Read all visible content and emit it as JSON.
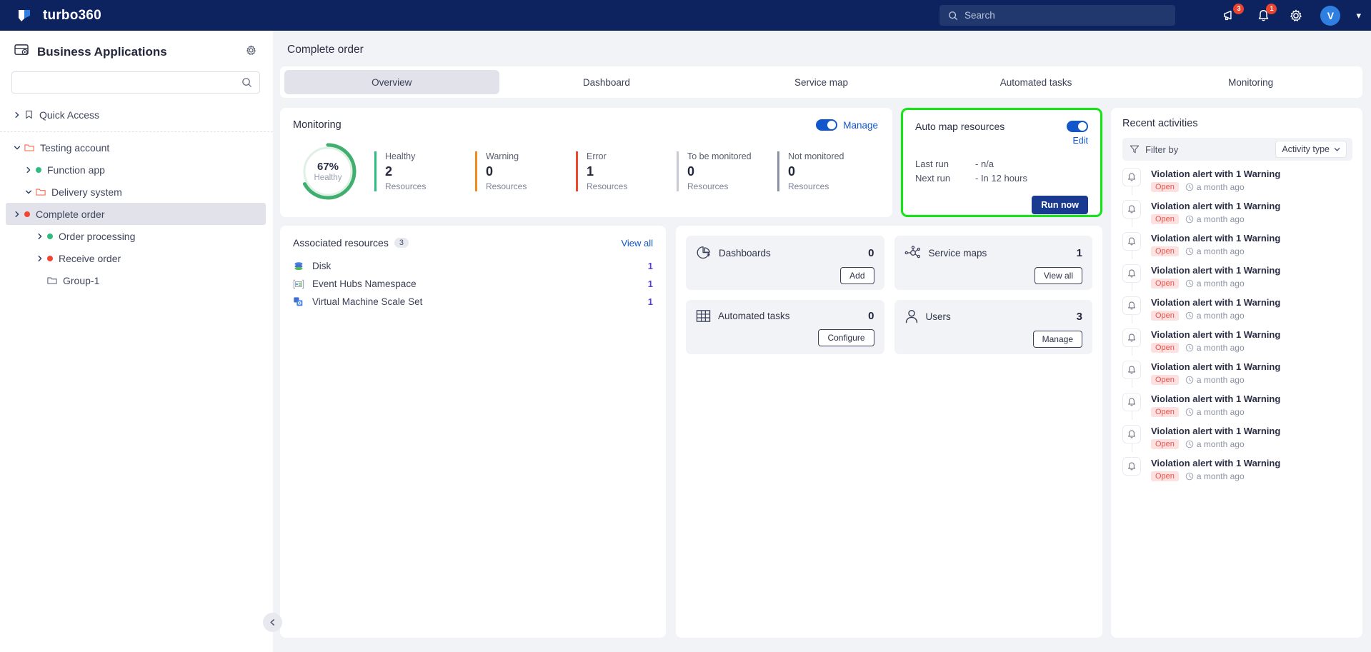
{
  "header": {
    "brand": "turbo360",
    "logo_icon": "turbo-logo-icon",
    "search_placeholder": "Search",
    "search_icon": "search-icon",
    "announcement_icon": "megaphone-icon",
    "announcement_badge": "3",
    "notification_icon": "bell-icon",
    "notification_badge": "1",
    "settings_icon": "gear-icon",
    "avatar_initial": "V",
    "avatar_chevron_icon": "chevron-down-icon"
  },
  "sidebar": {
    "title": "Business Applications",
    "title_icon": "business-applications-icon",
    "settings_icon": "gear-icon",
    "search_value": "",
    "search_icon": "search-icon",
    "collapse_icon": "chevron-left-icon",
    "tree": [
      {
        "label": "Quick Access",
        "icon": "bookmark-icon",
        "chevron": "right",
        "indent": 0,
        "selected": false
      },
      {
        "label": "Testing account",
        "icon": "folder-icon-orange",
        "chevron": "down",
        "indent": 0,
        "selected": false
      },
      {
        "label": "Function app",
        "icon": "status-dot-green",
        "chevron": "right",
        "indent": 1,
        "selected": false
      },
      {
        "label": "Delivery system",
        "icon": "folder-icon-orange",
        "chevron": "down",
        "indent": 1,
        "selected": false
      },
      {
        "label": "Complete order",
        "icon": "status-dot-red",
        "chevron": "right",
        "indent": 2,
        "selected": true
      },
      {
        "label": "Order processing",
        "icon": "status-dot-green",
        "chevron": "right",
        "indent": 2,
        "selected": false
      },
      {
        "label": "Receive order",
        "icon": "status-dot-red",
        "chevron": "right",
        "indent": 2,
        "selected": false
      },
      {
        "label": "Group-1",
        "icon": "folder-icon-gray",
        "chevron": "none",
        "indent": 2,
        "selected": false
      }
    ]
  },
  "page": {
    "title": "Complete order",
    "tabs": [
      {
        "label": "Overview",
        "active": true
      },
      {
        "label": "Dashboard",
        "active": false
      },
      {
        "label": "Service map",
        "active": false
      },
      {
        "label": "Automated tasks",
        "active": false
      },
      {
        "label": "Monitoring",
        "active": false
      }
    ]
  },
  "monitoring": {
    "title": "Monitoring",
    "manage_label": "Manage",
    "toggle_on": true,
    "donut": {
      "percent": "67%",
      "sub": "Healthy",
      "value": 67,
      "color": "#3fae6f",
      "track": "#dff0e5"
    },
    "stats": [
      {
        "key": "Healthy",
        "value": "2",
        "unit": "Resources",
        "color": "#2ebd7e"
      },
      {
        "key": "Warning",
        "value": "0",
        "unit": "Resources",
        "color": "#f08a1c"
      },
      {
        "key": "Error",
        "value": "1",
        "unit": "Resources",
        "color": "#f1452f"
      },
      {
        "key": "To be monitored",
        "value": "0",
        "unit": "Resources",
        "color": "#c7cad4"
      },
      {
        "key": "Not monitored",
        "value": "0",
        "unit": "Resources",
        "color": "#8b90a2"
      }
    ]
  },
  "auto_map": {
    "title": "Auto map resources",
    "toggle_on": true,
    "edit_label": "Edit",
    "last_run_key": "Last run",
    "last_run_value": "- n/a",
    "next_run_key": "Next run",
    "next_run_value": "- In 12 hours",
    "run_now_label": "Run now",
    "highlight_color": "#14e514"
  },
  "associated_resources": {
    "title": "Associated resources",
    "count": "3",
    "view_all_label": "View all",
    "rows": [
      {
        "name": "Disk",
        "count": "1",
        "icon": "azure-disk-icon"
      },
      {
        "name": "Event Hubs Namespace",
        "count": "1",
        "icon": "azure-event-hubs-icon"
      },
      {
        "name": "Virtual Machine Scale Set",
        "count": "1",
        "icon": "azure-vmss-icon"
      }
    ]
  },
  "tiles": [
    {
      "name": "Dashboards",
      "value": "0",
      "button": "Add",
      "icon": "pie-chart-icon"
    },
    {
      "name": "Service maps",
      "value": "1",
      "button": "View all",
      "icon": "service-map-icon"
    },
    {
      "name": "Automated tasks",
      "value": "0",
      "button": "Configure",
      "icon": "automated-tasks-icon"
    },
    {
      "name": "Users",
      "value": "3",
      "button": "Manage",
      "icon": "user-icon"
    }
  ],
  "recent_activities": {
    "title": "Recent activities",
    "filter_label": "Filter by",
    "filter_icon": "funnel-icon",
    "select_label": "Activity type",
    "select_icon": "chevron-down-icon",
    "items": [
      {
        "message": "Violation alert with 1 Warning",
        "status": "Open",
        "time": "a month ago",
        "icon": "bell-icon"
      },
      {
        "message": "Violation alert with 1 Warning",
        "status": "Open",
        "time": "a month ago",
        "icon": "bell-icon"
      },
      {
        "message": "Violation alert with 1 Warning",
        "status": "Open",
        "time": "a month ago",
        "icon": "bell-icon"
      },
      {
        "message": "Violation alert with 1 Warning",
        "status": "Open",
        "time": "a month ago",
        "icon": "bell-icon"
      },
      {
        "message": "Violation alert with 1 Warning",
        "status": "Open",
        "time": "a month ago",
        "icon": "bell-icon"
      },
      {
        "message": "Violation alert with 1 Warning",
        "status": "Open",
        "time": "a month ago",
        "icon": "bell-icon"
      },
      {
        "message": "Violation alert with 1 Warning",
        "status": "Open",
        "time": "a month ago",
        "icon": "bell-icon"
      },
      {
        "message": "Violation alert with 1 Warning",
        "status": "Open",
        "time": "a month ago",
        "icon": "bell-icon"
      },
      {
        "message": "Violation alert with 1 Warning",
        "status": "Open",
        "time": "a month ago",
        "icon": "bell-icon"
      },
      {
        "message": "Violation alert with 1 Warning",
        "status": "Open",
        "time": "a month ago",
        "icon": "bell-icon"
      }
    ]
  }
}
